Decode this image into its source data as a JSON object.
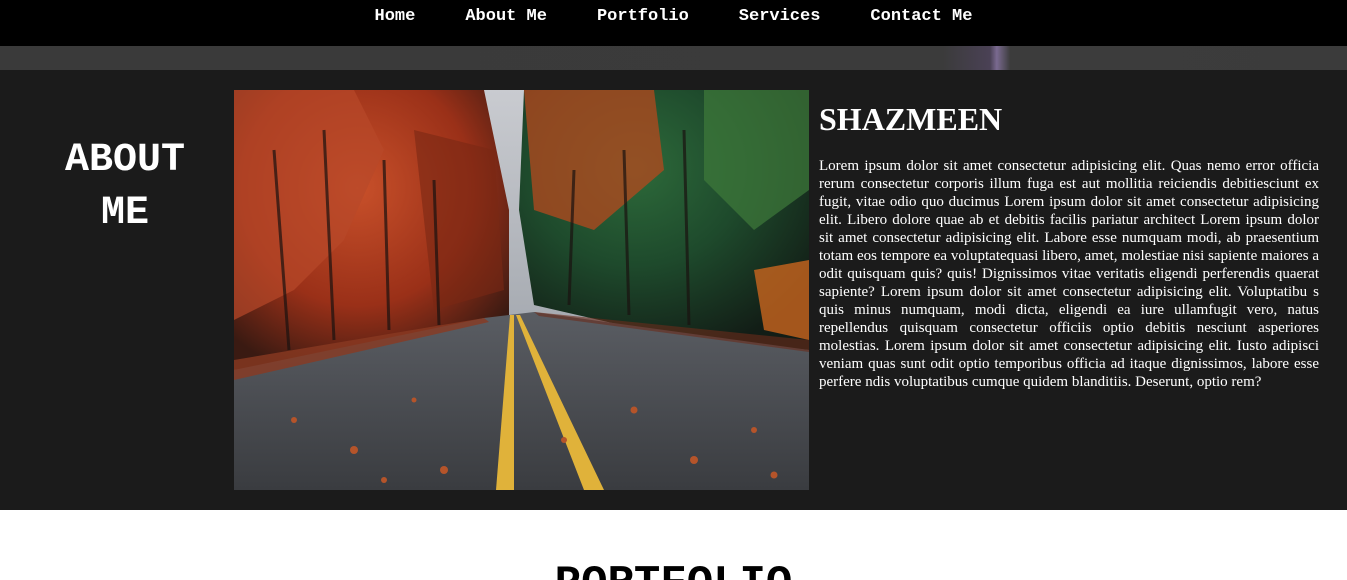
{
  "nav": {
    "items": [
      {
        "label": "Home"
      },
      {
        "label": "About Me"
      },
      {
        "label": "Portfolio"
      },
      {
        "label": "Services"
      },
      {
        "label": "Contact Me"
      }
    ]
  },
  "about": {
    "heading": "ABOUT ME",
    "photo_subject": "autumn road lined with red and orange trees",
    "name": "SHAZMEEN",
    "text": "Lorem ipsum dolor sit amet consectetur adipisicing elit. Quas nemo error officia rerum consectetur corporis illum fuga est aut mollitia reiciendis debitiesciunt ex fugit, vitae odio quo ducimus Lorem ipsum dolor sit amet consectetur adipisicing elit. Libero dolore quae ab et debitis facilis pariatur architect Lorem ipsum dolor sit amet consectetur adipisicing elit. Labore esse numquam modi, ab praesentium totam eos tempore ea voluptatequasi libero, amet, molestiae nisi sapiente maiores a odit quisquam quis? quis! Dignissimos vitae veritatis eligendi perferendis quaerat sapiente? Lorem ipsum dolor sit amet consectetur adipisicing elit. Voluptatibu s quis minus numquam, modi dicta, eligendi ea iure ullamfugit vero, natus repellendus quisquam consectetur officiis optio debitis nesciunt asperiores molestias. Lorem ipsum dolor sit amet consectetur adipisicing elit. Iusto adipisci veniam quas sunt odit optio temporibus officia ad itaque dignissimos, labore esse perfere ndis voluptatibus cumque quidem blanditiis. Deserunt, optio rem?"
  },
  "portfolio": {
    "heading": "PORTFOLIO"
  },
  "colors": {
    "nav_bg": "#000000",
    "section_bg": "#1b1b1b",
    "text_light": "#ffffff"
  }
}
